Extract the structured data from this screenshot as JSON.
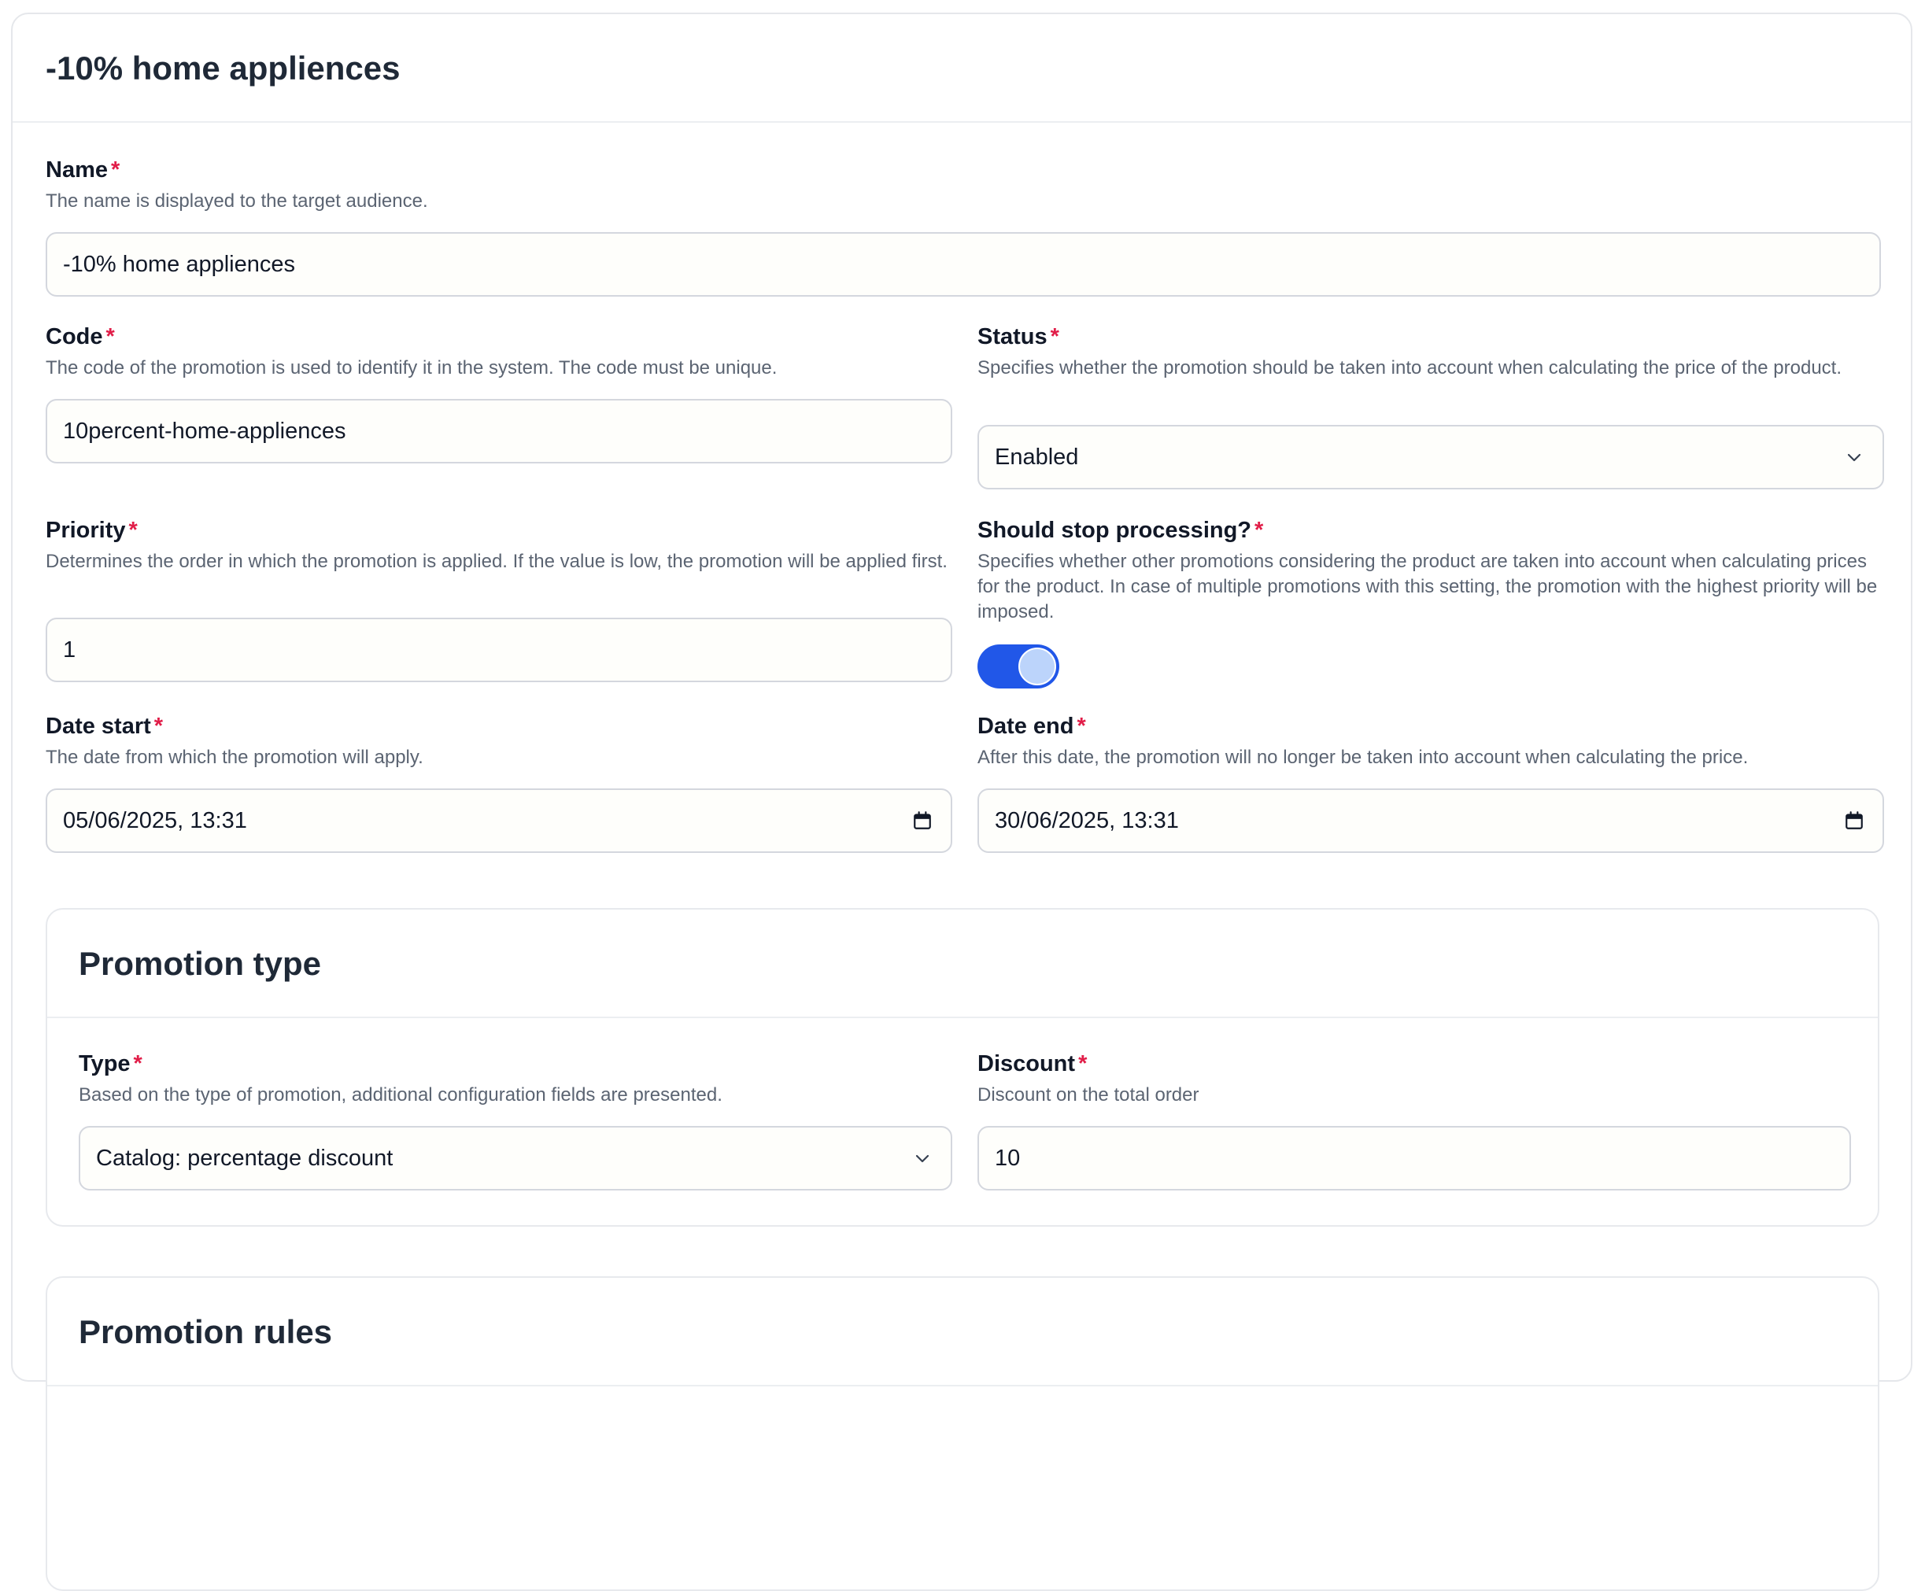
{
  "header": {
    "title": "-10% home appliences"
  },
  "form": {
    "name": {
      "label": "Name",
      "required": "*",
      "help": "The name is displayed to the target audience.",
      "value": "-10% home appliences"
    },
    "code": {
      "label": "Code",
      "required": "*",
      "help": "The code of the promotion is used to identify it in the system. The code must be unique.",
      "value": "10percent-home-appliences"
    },
    "status": {
      "label": "Status",
      "required": "*",
      "help": "Specifies whether the promotion should be taken into account when calculating the price of the product.",
      "value": "Enabled",
      "icon": "chevron-down-icon"
    },
    "priority": {
      "label": "Priority",
      "required": "*",
      "help": "Determines the order in which the promotion is applied. If the value is low, the promotion will be applied first.",
      "value": "1"
    },
    "stop_processing": {
      "label": "Should stop processing?",
      "required": "*",
      "help": "Specifies whether other promotions considering the product are taken into account when calculating prices for the product. In case of multiple promotions with this setting, the promotion with the highest priority will be imposed.",
      "enabled": true,
      "accent": "#2157e8"
    },
    "date_start": {
      "label": "Date start",
      "required": "*",
      "help": "The date from which the promotion will apply.",
      "value": "05/06/2025, 13:31",
      "icon": "calendar-icon"
    },
    "date_end": {
      "label": "Date end",
      "required": "*",
      "help": "After this date, the promotion will no longer be taken into account when calculating the price.",
      "value": "30/06/2025, 13:31",
      "icon": "calendar-icon"
    }
  },
  "promotion_type": {
    "title": "Promotion type",
    "type": {
      "label": "Type",
      "required": "*",
      "help": "Based on the type of promotion, additional configuration fields are presented.",
      "value": "Catalog: percentage discount",
      "icon": "chevron-down-icon"
    },
    "discount": {
      "label": "Discount",
      "required": "*",
      "help": "Discount on the total order",
      "value": "10"
    }
  },
  "promotion_rules": {
    "title": "Promotion rules"
  },
  "colors": {
    "required_marker": "#e11d48",
    "toggle_on": "#2157e8",
    "border": "#d4d7de"
  }
}
